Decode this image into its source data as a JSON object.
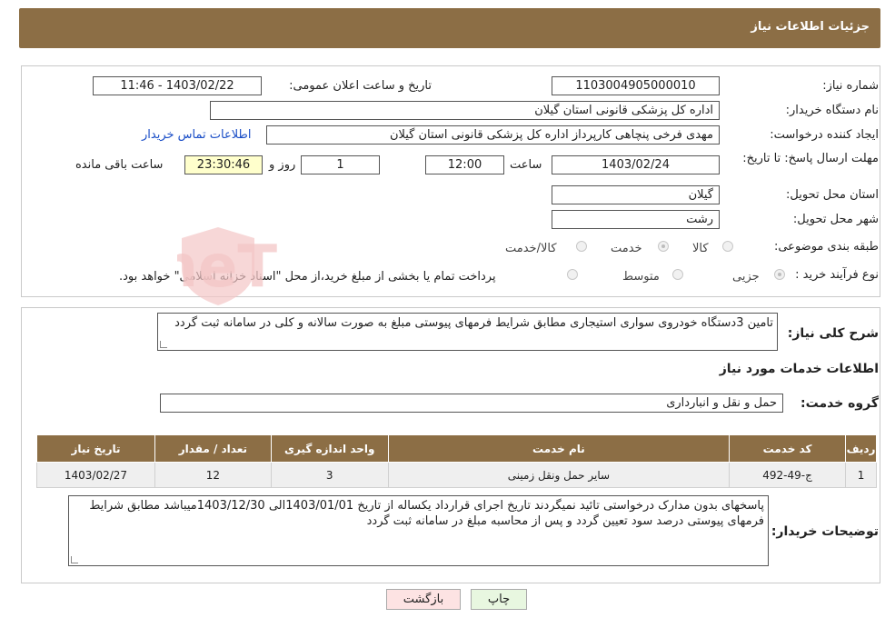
{
  "header": {
    "title": "جزئیات اطلاعات نیاز"
  },
  "form": {
    "need_number_label": "شماره نیاز:",
    "need_number": "1103004905000010",
    "announce_label": "تاریخ و ساعت اعلان عمومی:",
    "announce_value": "1403/02/22 - 11:46",
    "buyer_org_label": "نام دستگاه خریدار:",
    "buyer_org": "اداره کل پزشکی قانونی استان گیلان",
    "creator_label": "ایجاد کننده درخواست:",
    "creator": "مهدی فرخی پنچاهی کارپرداز  اداره کل پزشکی قانونی استان گیلان",
    "contact_link": "اطلاعات تماس خریدار",
    "deadline_label": "مهلت ارسال پاسخ: تا تاریخ:",
    "deadline_date": "1403/02/24",
    "time_label": "ساعت",
    "deadline_time": "12:00",
    "days_value": "1",
    "days_label": "روز و",
    "remaining_value": "23:30:46",
    "remaining_label": "ساعت باقی مانده",
    "province_label": "استان محل تحویل:",
    "province": "گیلان",
    "city_label": "شهر محل تحویل:",
    "city": "رشت",
    "category_label": "طبقه بندی موضوعی:",
    "category_options": [
      "کالا",
      "خدمت",
      "کالا/خدمت"
    ],
    "purchase_type_label": "نوع فرآیند خرید :",
    "purchase_options": [
      "جزیی",
      "متوسط"
    ],
    "payment_note": "پرداخت تمام یا بخشی از مبلغ خرید،از محل \"اسناد خزانه اسلامی\" خواهد بود."
  },
  "summary": {
    "label": "شرح کلی نیاز:",
    "text": "تامین 3دستگاه خودروی سواری استیجاری مطابق شرایط فرمهای پیوستی مبلغ به صورت سالانه و کلی در سامانه ثبت گردد"
  },
  "services": {
    "section_title": "اطلاعات خدمات مورد نیاز",
    "group_label": "گروه خدمت:",
    "group_value": "حمل و نقل و انبارداری",
    "columns": [
      "ردیف",
      "کد خدمت",
      "نام خدمت",
      "واحد اندازه گیری",
      "تعداد / مقدار",
      "تاریخ نیاز"
    ],
    "rows": [
      [
        "1",
        "ج-49-492",
        "سایر حمل ونقل زمینی",
        "3",
        "12",
        "1403/02/27"
      ]
    ]
  },
  "buyer_notes": {
    "label": "توضیحات خریدار:",
    "text": "پاسخهای  بدون مدارک درخواستی تائید نمیگردند تاریخ اجرای قرارداد یکساله از تاریخ 1403/01/01الی 1403/12/30میباشد مطابق شرایط فرمهای پیوستی  درصد سود  تعیین گردد و پس از محاسبه مبلغ در سامانه ثبت گردد"
  },
  "buttons": {
    "print": "چاپ",
    "back": "بازگشت"
  },
  "colors": {
    "header": "#8c6e45",
    "watermark": "#f3c6c6",
    "link": "#1a4ec7"
  }
}
